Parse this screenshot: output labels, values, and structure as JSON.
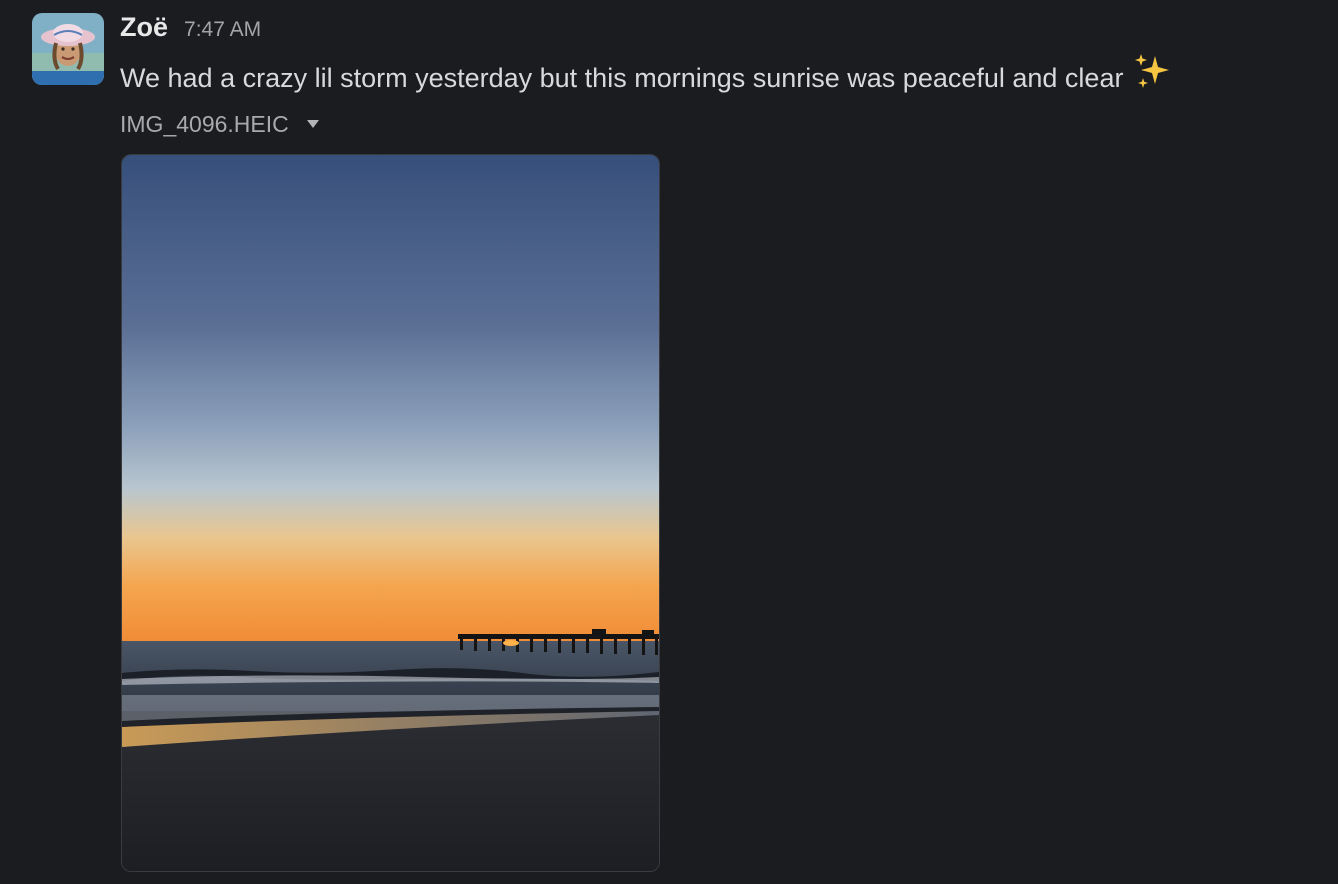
{
  "message": {
    "author": "Zoë",
    "timestamp": "7:47 AM",
    "text": "We had a crazy lil storm yesterday but this mornings sunrise was peaceful and clear",
    "emoji": "sparkles-icon"
  },
  "attachment": {
    "file_name": "IMG_4096.HEIC",
    "kind": "photo",
    "subject": "sunrise over ocean with pier silhouette and beach"
  },
  "colors": {
    "background": "#1b1c20",
    "author": "#e8e8e9",
    "text": "#d8d9da",
    "muted": "#a3a4a6",
    "sparkle": "#f5c542"
  }
}
